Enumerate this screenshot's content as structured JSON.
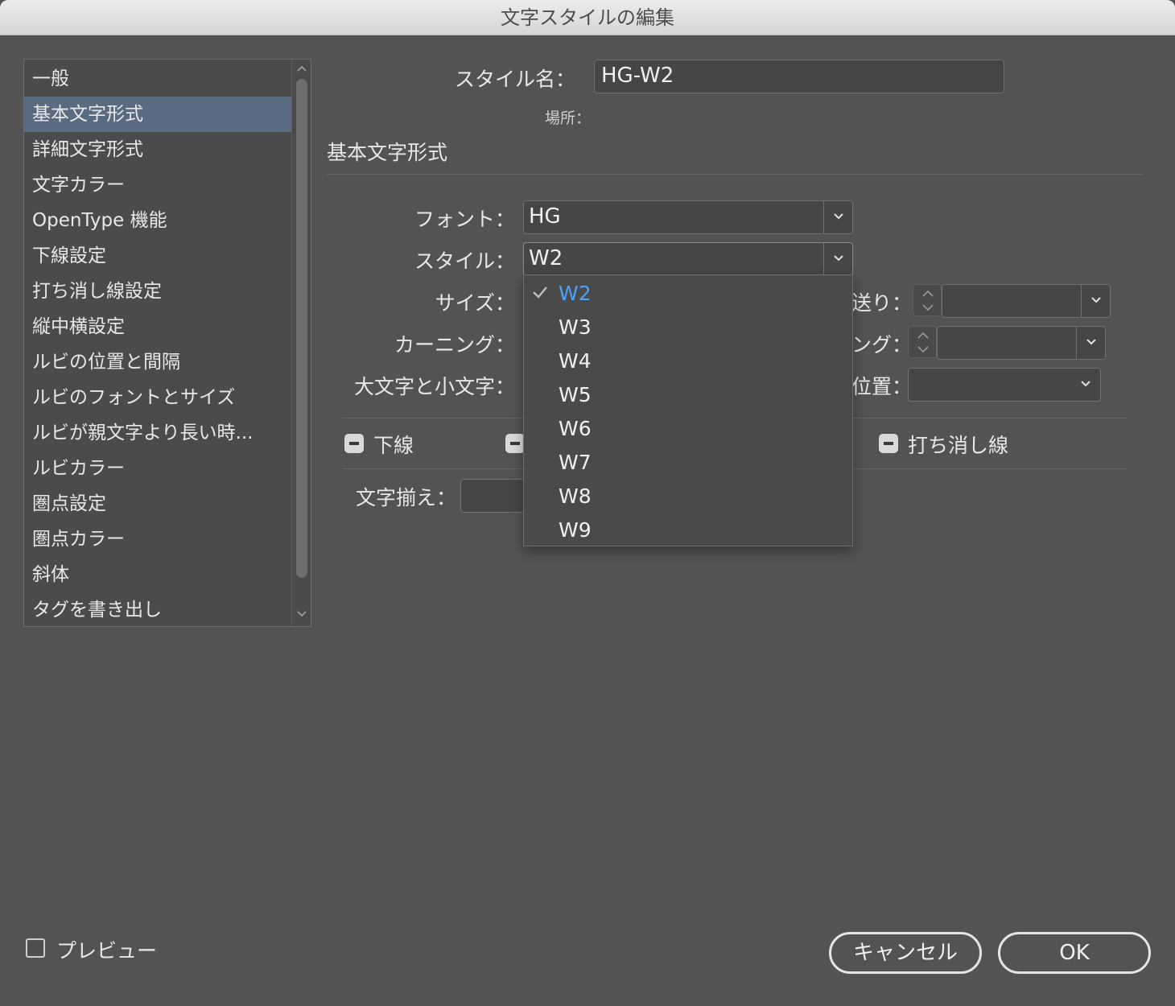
{
  "window": {
    "title": "文字スタイルの編集"
  },
  "sidebar": {
    "items": [
      "一般",
      "基本文字形式",
      "詳細文字形式",
      "文字カラー",
      "OpenType 機能",
      "下線設定",
      "打ち消し線設定",
      "縦中横設定",
      "ルビの位置と間隔",
      "ルビのフォントとサイズ",
      "ルビが親文字より長い時...",
      "ルビカラー",
      "圏点設定",
      "圏点カラー",
      "斜体",
      "タグを書き出し"
    ],
    "selected": "基本文字形式"
  },
  "header": {
    "style_name_label": "スタイル名：",
    "style_name_value": "HG-W2",
    "location_label": "場所：",
    "section_title": "基本文字形式"
  },
  "form": {
    "font_label": "フォント：",
    "font_value": "HG",
    "style_label": "スタイル：",
    "style_value": "W2",
    "size_label": "サイズ：",
    "kerning_label": "カーニング：",
    "case_label": "大文字と小文字：",
    "leading_label_partial": "送り：",
    "tracking_label_partial": "ング：",
    "position_label_partial": "位置：",
    "underline_label": "下線",
    "strikethrough_label": "打ち消し線",
    "align_label": "文字揃え："
  },
  "style_menu": {
    "options": [
      "W2",
      "W3",
      "W4",
      "W5",
      "W6",
      "W7",
      "W8",
      "W9"
    ],
    "checked": "W2",
    "check_color": "#4aa3ff"
  },
  "footer": {
    "preview_label": "プレビュー",
    "preview_checked": false,
    "cancel_label": "キャンセル",
    "ok_label": "OK"
  }
}
